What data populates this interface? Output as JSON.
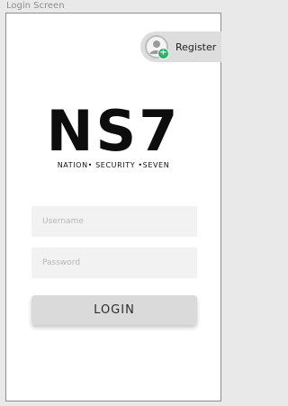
{
  "window": {
    "title": "Login Screen"
  },
  "header": {
    "register_label": "Register"
  },
  "logo": {
    "mark": "NS7",
    "tagline": "NATION• SECURITY •SEVEN"
  },
  "form": {
    "username_placeholder": "Username",
    "password_placeholder": "Password",
    "login_label": "LOGIN"
  },
  "colors": {
    "background": "#e9e9e9",
    "screen": "#ffffff",
    "field": "#f2f2f2",
    "button": "#dadada",
    "badge": "#2faf6a"
  },
  "icons": {
    "register": "add-user-icon",
    "badge": "plus-icon"
  }
}
